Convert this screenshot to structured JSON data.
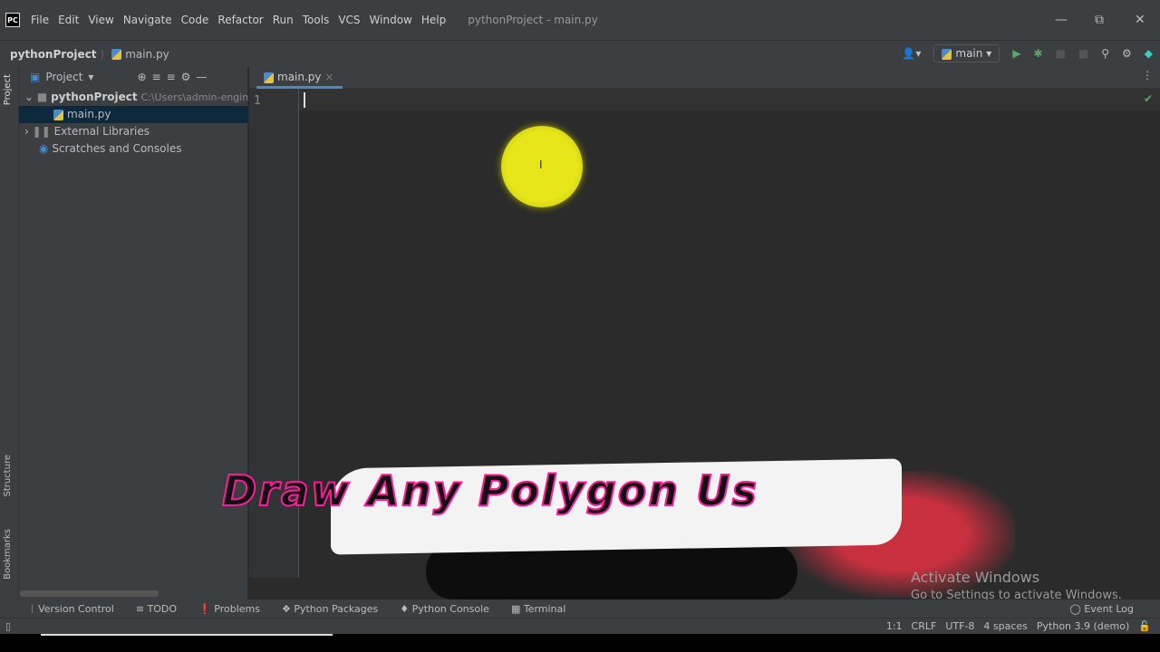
{
  "app": {
    "logo": "PC",
    "title": "pythonProject - main.py"
  },
  "menu": [
    "File",
    "Edit",
    "View",
    "Navigate",
    "Code",
    "Refactor",
    "Run",
    "Tools",
    "VCS",
    "Window",
    "Help"
  ],
  "breadcrumb": {
    "project": "pythonProject",
    "file": "main.py"
  },
  "toolbar": {
    "run_config": "main"
  },
  "side_tabs": {
    "project": "Project",
    "structure": "Structure",
    "bookmarks": "Bookmarks"
  },
  "project_panel": {
    "title": "Project",
    "root": "pythonProject",
    "root_path": "C:\\Users\\admin-engineer\\P",
    "file": "main.py",
    "external": "External Libraries",
    "scratches": "Scratches and Consoles"
  },
  "editor": {
    "tab": "main.py",
    "line": "1"
  },
  "overlay": {
    "text": "Draw Any Polygon Us"
  },
  "watermark": {
    "line1": "Activate Windows",
    "line2": "Go to Settings to activate Windows."
  },
  "tool_windows": [
    "Version Control",
    "TODO",
    "Problems",
    "Python Packages",
    "Python Console",
    "Terminal"
  ],
  "event_log": "Event Log",
  "status": {
    "position": "1:1",
    "line_sep": "CRLF",
    "encoding": "UTF-8",
    "indent": "4 spaces",
    "interpreter": "Python 3.9 (demo)"
  }
}
